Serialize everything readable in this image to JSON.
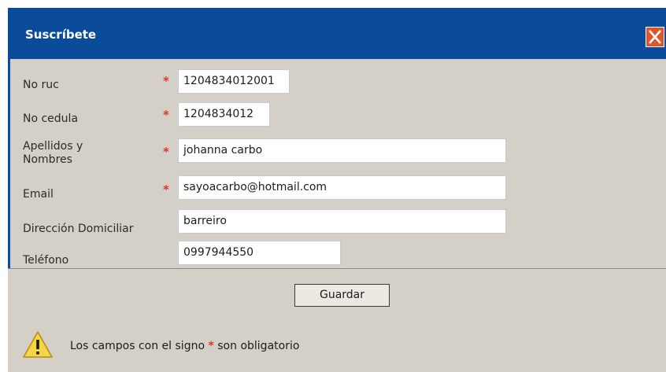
{
  "dialog": {
    "title": "Suscríbete"
  },
  "form": {
    "fields": [
      {
        "label": "No ruc",
        "value": "1204834012001",
        "required": true
      },
      {
        "label": "No cedula",
        "value": "1204834012",
        "required": true
      },
      {
        "label": "Apellidos y Nombres",
        "value": "johanna carbo",
        "required": true
      },
      {
        "label": "Email",
        "value": "sayoacarbo@hotmail.com",
        "required": true
      },
      {
        "label": "Dirección Domiciliar",
        "value": "barreiro",
        "required": false
      },
      {
        "label": "Teléfono",
        "value": "0997944550",
        "required": false
      }
    ],
    "required_marker": "*"
  },
  "footer": {
    "save_label": "Guardar",
    "note_before": "Los campos con el signo",
    "note_marker": "*",
    "note_after": "son obligatorio"
  },
  "colors": {
    "titlebar": "#0a4c9a",
    "panel": "#d4d0c8",
    "required": "#e0342a",
    "close": "#e1552c"
  },
  "icons": {
    "close": "close-icon",
    "warning": "warning-icon"
  }
}
